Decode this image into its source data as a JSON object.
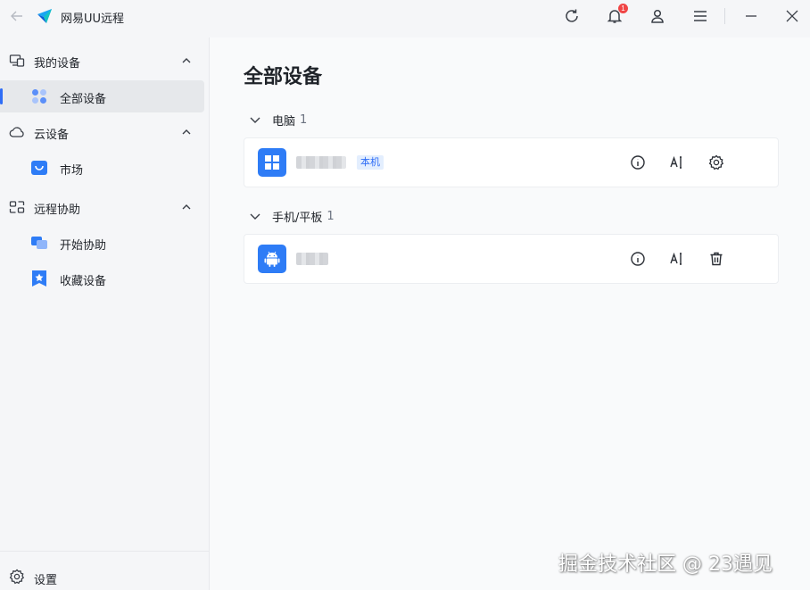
{
  "app": {
    "title": "网易UU远程"
  },
  "titlebar": {
    "notification_count": "1"
  },
  "sidebar": {
    "sections": [
      {
        "label": "我的设备",
        "items": [
          {
            "label": "全部设备",
            "active": true
          }
        ]
      },
      {
        "label": "云设备",
        "items": [
          {
            "label": "市场",
            "active": false
          }
        ]
      },
      {
        "label": "远程协助",
        "items": [
          {
            "label": "开始协助",
            "active": false
          },
          {
            "label": "收藏设备",
            "active": false
          }
        ]
      }
    ],
    "settings_label": "设置"
  },
  "main": {
    "title": "全部设备",
    "groups": [
      {
        "label": "电脑",
        "count": "1",
        "devices": [
          {
            "name": "▒▒▒▒▒▒▒",
            "badge": "本机",
            "os": "windows"
          }
        ]
      },
      {
        "label": "手机/平板",
        "count": "1",
        "devices": [
          {
            "name": "▒▒▒▒",
            "os": "android"
          }
        ]
      }
    ]
  },
  "watermark": "掘金技术社区 @ 23遇见",
  "colors": {
    "accent": "#2e6df6",
    "device_icon": "#2e7cf6",
    "badge_bg": "#e3eefe",
    "notification": "#f04545"
  }
}
